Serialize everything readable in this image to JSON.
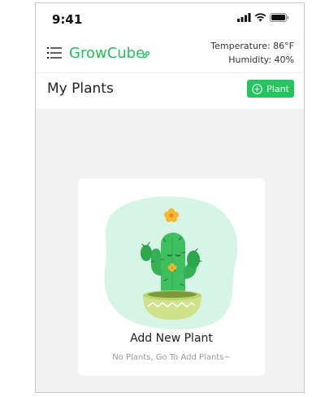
{
  "status_bar": {
    "time": "9:41",
    "icons": [
      "signal-icon",
      "wifi-icon",
      "battery-icon"
    ]
  },
  "header": {
    "app_name": "GrowCube",
    "temperature": "Temperature: 86°F",
    "humidity": "Humidity: 40%"
  },
  "title_row": {
    "title": "My Plants",
    "add_button_label": "Plant"
  },
  "empty_state": {
    "title": "Add New Plant",
    "subtitle": "No Plants, Go To Add Plants~",
    "illustration": "potted-cactus-illustration"
  },
  "colors": {
    "accent": "#22c55e",
    "brand_text": "#22bf5a",
    "background": "#f2f2f2",
    "blob": "#d6f5e6"
  }
}
